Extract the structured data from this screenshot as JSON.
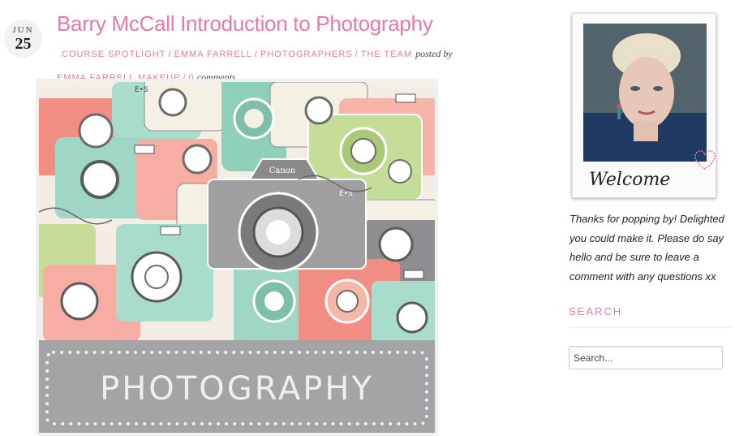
{
  "post": {
    "date": {
      "month": "JUN",
      "day": "25"
    },
    "title": "Barry McCall Introduction to Photography",
    "categories": [
      "COURSE SPOTLIGHT",
      "EMMA FARRELL",
      "PHOTOGRAPHERS",
      "THE TEAM"
    ],
    "posted_by_label": "posted by",
    "author": "EMMA FARRELL MAKEUP",
    "comment_count": "0",
    "comments_label": "comments",
    "image": {
      "camera_brand_1": "E•S",
      "camera_brand_2": "Canon",
      "camera_brand_3": "E•S",
      "banner_text": "PHOTOGRAPHY"
    }
  },
  "sidebar": {
    "welcome_caption": "Welcome",
    "welcome_text": "Thanks for popping by! Delighted you could make it. Please do say hello and be sure to leave a comment with any questions xx",
    "search_title": "SEARCH",
    "search_placeholder": "Search..."
  },
  "colors": {
    "accent": "#e27ba5",
    "camera_pink": "#f2a29a",
    "camera_green": "#c6dd9a",
    "camera_teal": "#a8dccb",
    "camera_grey": "#9f9ea0",
    "banner_grey": "#a4a3a5"
  }
}
